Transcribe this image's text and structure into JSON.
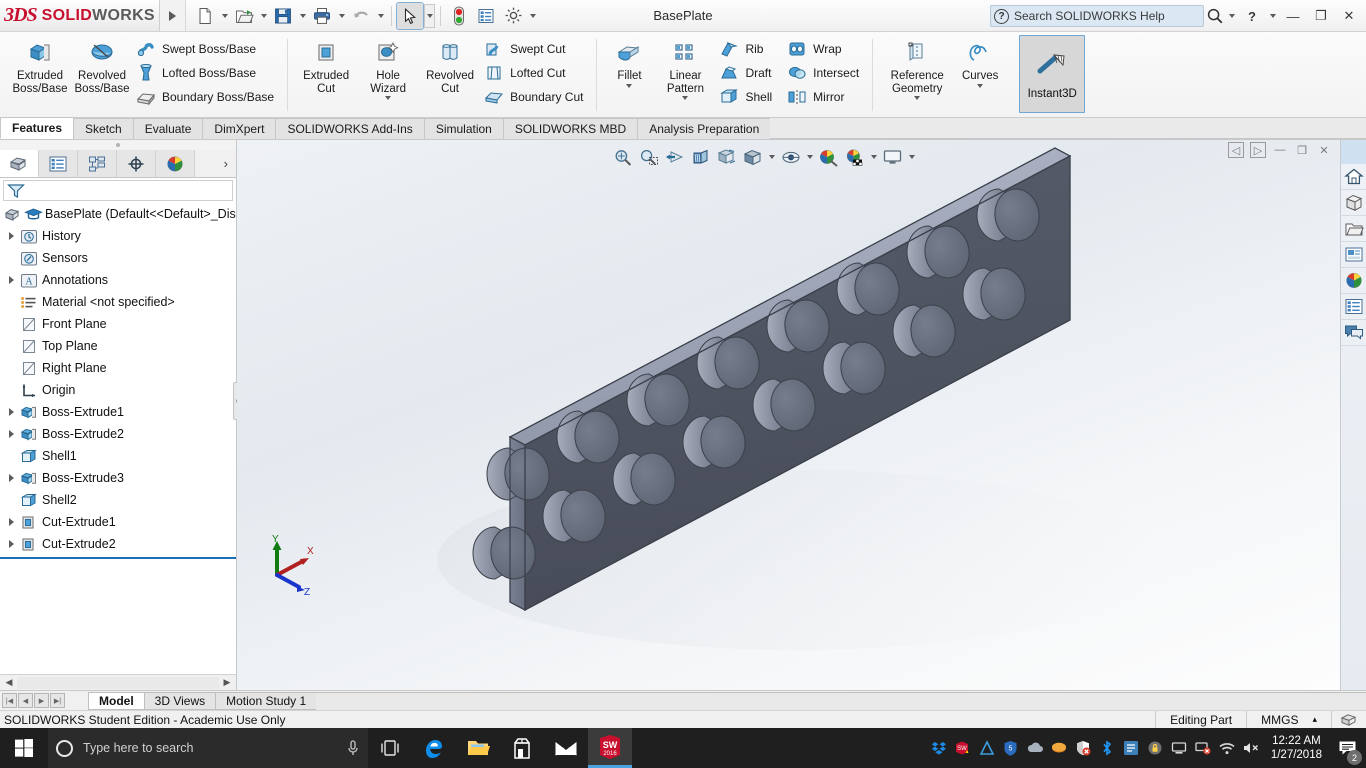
{
  "window": {
    "app_name_ds": "3DS",
    "app_name_solid": "SOLID",
    "app_name_works": "WORKS",
    "document_title": "BasePlate",
    "minimize": "—",
    "restore": "❐",
    "close": "✕",
    "help": "?",
    "help_caret": "▾"
  },
  "search": {
    "placeholder": "Search SOLIDWORKS Help",
    "value": "Search SOLIDWORKS Help",
    "icon": "help-circle-icon",
    "magnifier": "magnifier-icon"
  },
  "quick_access": [
    {
      "name": "new-document-icon",
      "has_caret": true
    },
    {
      "name": "open-document-icon",
      "has_caret": true
    },
    {
      "name": "save-icon",
      "has_caret": true
    },
    {
      "name": "print-icon",
      "has_caret": true
    },
    {
      "name": "undo-icon",
      "has_caret": true
    },
    {
      "name": "select-pointer-icon",
      "has_caret": true
    },
    {
      "name": "rebuild-traffic-light-icon",
      "has_caret": false
    },
    {
      "name": "options-list-icon",
      "has_caret": false
    },
    {
      "name": "settings-gear-icon",
      "has_caret": true
    }
  ],
  "ribbon": {
    "groups": [
      {
        "id": "boss-base",
        "big": [
          {
            "label_line1": "Extruded",
            "label_line2": "Boss/Base",
            "icon": "extruded-boss-icon",
            "caret": false
          },
          {
            "label_line1": "Revolved",
            "label_line2": "Boss/Base",
            "icon": "revolved-boss-icon",
            "caret": false
          }
        ],
        "small": [
          {
            "label": "Swept Boss/Base",
            "icon": "swept-boss-icon"
          },
          {
            "label": "Lofted Boss/Base",
            "icon": "lofted-boss-icon"
          },
          {
            "label": "Boundary Boss/Base",
            "icon": "boundary-boss-icon"
          }
        ]
      },
      {
        "id": "cut",
        "big": [
          {
            "label_line1": "Extruded",
            "label_line2": "Cut",
            "icon": "extruded-cut-icon",
            "caret": false
          },
          {
            "label_line1": "Hole",
            "label_line2": "Wizard",
            "icon": "hole-wizard-icon",
            "caret": true
          },
          {
            "label_line1": "Revolved",
            "label_line2": "Cut",
            "icon": "revolved-cut-icon",
            "caret": false
          }
        ],
        "small": [
          {
            "label": "Swept Cut",
            "icon": "swept-cut-icon"
          },
          {
            "label": "Lofted Cut",
            "icon": "lofted-cut-icon"
          },
          {
            "label": "Boundary Cut",
            "icon": "boundary-cut-icon"
          }
        ]
      },
      {
        "id": "features",
        "big": [
          {
            "label_line1": "Fillet",
            "label_line2": "",
            "icon": "fillet-icon",
            "caret": true
          },
          {
            "label_line1": "Linear",
            "label_line2": "Pattern",
            "icon": "linear-pattern-icon",
            "caret": true
          }
        ],
        "small": [
          {
            "label": "Rib",
            "icon": "rib-icon"
          },
          {
            "label": "Draft",
            "icon": "draft-icon"
          },
          {
            "label": "Shell",
            "icon": "shell-icon"
          }
        ],
        "small2": [
          {
            "label": "Wrap",
            "icon": "wrap-icon"
          },
          {
            "label": "Intersect",
            "icon": "intersect-icon"
          },
          {
            "label": "Mirror",
            "icon": "mirror-icon"
          }
        ]
      },
      {
        "id": "reference",
        "big": [
          {
            "label_line1": "Reference",
            "label_line2": "Geometry",
            "icon": "reference-geometry-icon",
            "caret": true
          },
          {
            "label_line1": "Curves",
            "label_line2": "",
            "icon": "curves-icon",
            "caret": true
          }
        ],
        "small": []
      }
    ],
    "instant3d": {
      "label": "Instant3D",
      "icon": "instant3d-icon",
      "active": true
    }
  },
  "command_tabs": [
    {
      "label": "Features",
      "active": true
    },
    {
      "label": "Sketch",
      "active": false
    },
    {
      "label": "Evaluate",
      "active": false
    },
    {
      "label": "DimXpert",
      "active": false
    },
    {
      "label": "SOLIDWORKS Add-Ins",
      "active": false
    },
    {
      "label": "Simulation",
      "active": false
    },
    {
      "label": "SOLIDWORKS MBD",
      "active": false
    },
    {
      "label": "Analysis Preparation",
      "active": false
    }
  ],
  "left_panel": {
    "tabs": [
      {
        "name": "feature-manager-tab",
        "icon": "feature-tree-icon",
        "active": true
      },
      {
        "name": "property-manager-tab",
        "icon": "property-list-icon",
        "active": false
      },
      {
        "name": "configuration-manager-tab",
        "icon": "configuration-icon",
        "active": false
      },
      {
        "name": "dimxpert-manager-tab",
        "icon": "dimxpert-target-icon",
        "active": false
      },
      {
        "name": "display-manager-tab",
        "icon": "display-sphere-icon",
        "active": false
      }
    ],
    "more_chevron": "›",
    "filter_icon": "filter-funnel-icon",
    "tree": [
      {
        "label": "BasePlate  (Default<<Default>_Disp",
        "icon": "part-icon",
        "arrow": false,
        "indent": 0,
        "root": true
      },
      {
        "label": "History",
        "icon": "history-folder-icon",
        "arrow": true,
        "indent": 1
      },
      {
        "label": "Sensors",
        "icon": "sensors-folder-icon",
        "arrow": false,
        "indent": 1
      },
      {
        "label": "Annotations",
        "icon": "annotations-folder-icon",
        "arrow": true,
        "indent": 1
      },
      {
        "label": "Material <not specified>",
        "icon": "material-icon",
        "arrow": false,
        "indent": 1
      },
      {
        "label": "Front Plane",
        "icon": "plane-icon",
        "arrow": false,
        "indent": 1
      },
      {
        "label": "Top Plane",
        "icon": "plane-icon",
        "arrow": false,
        "indent": 1
      },
      {
        "label": "Right Plane",
        "icon": "plane-icon",
        "arrow": false,
        "indent": 1
      },
      {
        "label": "Origin",
        "icon": "origin-icon",
        "arrow": false,
        "indent": 1
      },
      {
        "label": "Boss-Extrude1",
        "icon": "boss-extrude-icon",
        "arrow": true,
        "indent": 1
      },
      {
        "label": "Boss-Extrude2",
        "icon": "boss-extrude-icon",
        "arrow": true,
        "indent": 1
      },
      {
        "label": "Shell1",
        "icon": "shell-feature-icon",
        "arrow": false,
        "indent": 1
      },
      {
        "label": "Boss-Extrude3",
        "icon": "boss-extrude-icon",
        "arrow": true,
        "indent": 1
      },
      {
        "label": "Shell2",
        "icon": "shell-feature-icon",
        "arrow": false,
        "indent": 1
      },
      {
        "label": "Cut-Extrude1",
        "icon": "cut-extrude-icon",
        "arrow": true,
        "indent": 1
      },
      {
        "label": "Cut-Extrude2",
        "icon": "cut-extrude-icon",
        "arrow": true,
        "indent": 1
      }
    ]
  },
  "viewport": {
    "hud": [
      {
        "name": "zoom-to-fit-icon",
        "caret": false
      },
      {
        "name": "zoom-to-area-icon",
        "caret": false
      },
      {
        "name": "previous-view-icon",
        "caret": false
      },
      {
        "name": "section-view-icon",
        "caret": false
      },
      {
        "name": "view-orientation-icon",
        "caret": false
      },
      {
        "name": "display-style-icon",
        "caret": true
      },
      {
        "name": "hide-show-items-icon",
        "caret": true
      },
      {
        "name": "edit-appearance-icon",
        "caret": true
      },
      {
        "name": "apply-scene-icon",
        "caret": true
      },
      {
        "name": "view-settings-icon",
        "caret": true
      }
    ],
    "win_controls": [
      {
        "name": "vp-prev-icon",
        "glyph": "◁"
      },
      {
        "name": "vp-next-icon",
        "glyph": "▷"
      },
      {
        "name": "vp-minimize-icon",
        "glyph": "—"
      },
      {
        "name": "vp-restore-icon",
        "glyph": "❐"
      },
      {
        "name": "vp-close-icon",
        "glyph": "✕"
      }
    ],
    "triad": {
      "x_label": "X",
      "y_label": "Y",
      "z_label": "Z",
      "x_color": "#b02020",
      "y_color": "#117a11",
      "z_color": "#1a35cc"
    },
    "model": {
      "name": "base-plate-model",
      "stud_rows": 2,
      "stud_cols": 8,
      "face_color": "#4a4f5a",
      "top_color": "#9aa1b4",
      "side_color": "#6f7688",
      "stud_color": "#7e8596"
    }
  },
  "right_strip": [
    {
      "name": "view-home-icon"
    },
    {
      "name": "appearances-library-icon"
    },
    {
      "name": "design-library-folder-icon"
    },
    {
      "name": "file-explorer-icon"
    },
    {
      "name": "view-palette-icon"
    },
    {
      "name": "custom-properties-icon"
    },
    {
      "name": "solidworks-forum-icon"
    }
  ],
  "bottom": {
    "nav_buttons": [
      "first-tab-icon",
      "prev-tab-icon",
      "next-tab-icon",
      "last-tab-icon"
    ],
    "tabs": [
      {
        "label": "Model",
        "active": true
      },
      {
        "label": "3D Views",
        "active": false
      },
      {
        "label": "Motion Study 1",
        "active": false
      }
    ]
  },
  "status": {
    "message": "SOLIDWORKS Student Edition - Academic Use Only",
    "editing": "Editing Part",
    "units": "MMGS",
    "units_caret": "▴",
    "tail_icon": "model-shape-icon"
  },
  "taskbar": {
    "start_icon": "windows-start-icon",
    "search_placeholder": "Type here to search",
    "mic_icon": "microphone-icon",
    "pinned": [
      {
        "name": "task-view-icon"
      },
      {
        "name": "microsoft-edge-icon"
      },
      {
        "name": "file-explorer-icon"
      },
      {
        "name": "microsoft-store-icon"
      },
      {
        "name": "mail-icon"
      },
      {
        "name": "solidworks-2016-icon",
        "label": "SW",
        "sublabel": "2016",
        "active": true
      }
    ],
    "tray": [
      {
        "name": "dropbox-tray-icon"
      },
      {
        "name": "solidworks-tray-icon"
      },
      {
        "name": "autodesk-tray-icon"
      },
      {
        "name": "shield-5-tray-icon"
      },
      {
        "name": "onedrive-tray-icon"
      },
      {
        "name": "orange-disc-tray-icon"
      },
      {
        "name": "windows-defender-tray-icon"
      },
      {
        "name": "bluetooth-tray-icon"
      },
      {
        "name": "network-app-tray-icon"
      },
      {
        "name": "security-lock-tray-icon"
      },
      {
        "name": "display-tray-icon"
      },
      {
        "name": "monitor-error-tray-icon"
      },
      {
        "name": "wifi-tray-icon"
      },
      {
        "name": "volume-muted-tray-icon"
      }
    ],
    "clock_time": "12:22 AM",
    "clock_date": "1/27/2018",
    "notification_count": "2"
  }
}
